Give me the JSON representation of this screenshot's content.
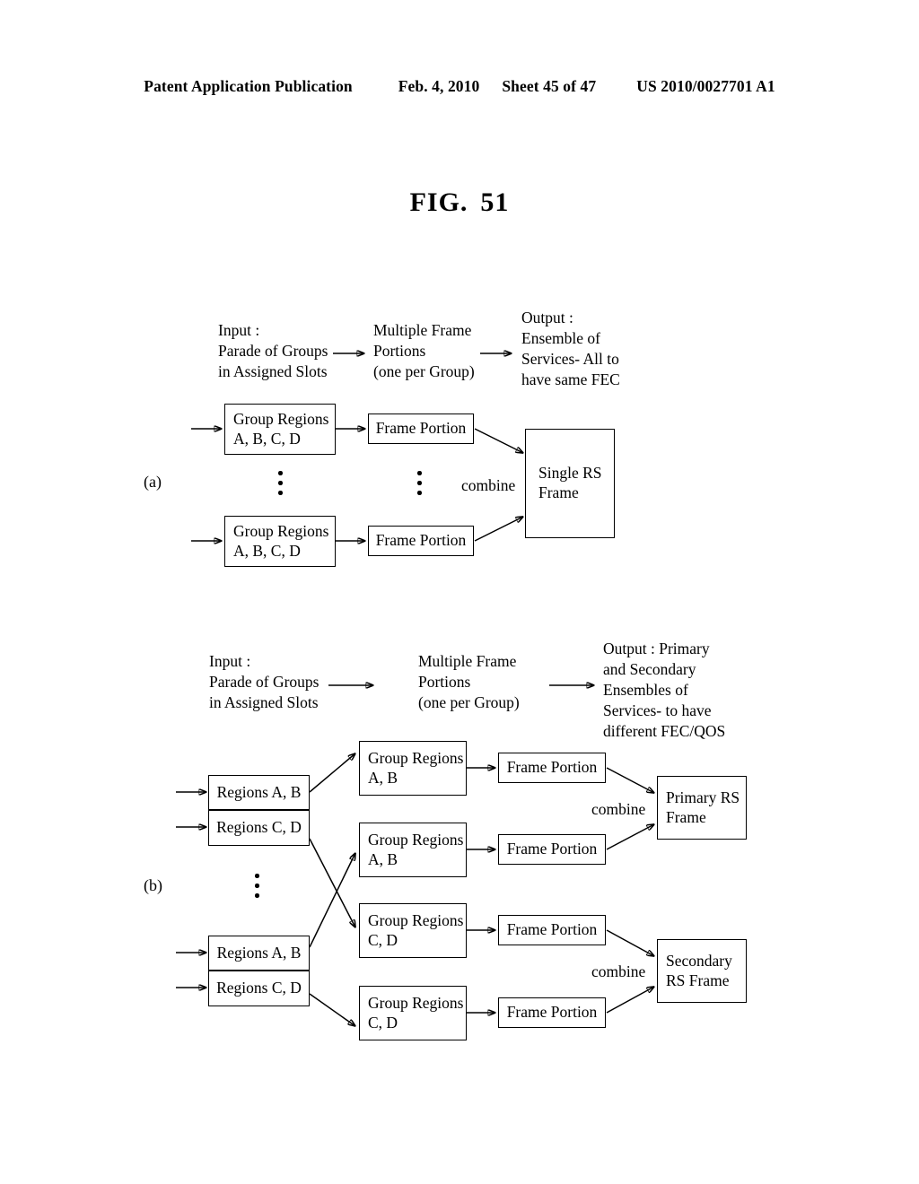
{
  "header": {
    "publication": "Patent Application Publication",
    "date": "Feb. 4, 2010",
    "sheet": "Sheet 45 of 47",
    "patent_number": "US 2010/0027701 A1"
  },
  "figure": {
    "label": "FIG.",
    "number": "51"
  },
  "part_a": {
    "label": "(a)",
    "captions": {
      "input": {
        "line1": "Input :",
        "line2": "Parade of Groups",
        "line3": "in Assigned Slots"
      },
      "middle": {
        "line1": "Multiple Frame",
        "line2": "Portions",
        "line3": "(one per Group)"
      },
      "output": {
        "line1": "Output :",
        "line2": "Ensemble of",
        "line3": "Services- All to",
        "line4": "have same FEC"
      }
    },
    "group_box_top": {
      "line1": "Group Regions",
      "line2": "A, B, C, D"
    },
    "group_box_bottom": {
      "line1": "Group Regions",
      "line2": "A, B, C, D"
    },
    "frame_portion_top": "Frame Portion",
    "frame_portion_bottom": "Frame Portion",
    "combine_label": "combine",
    "rs_frame": {
      "line1": "Single RS",
      "line2": "Frame"
    }
  },
  "part_b": {
    "label": "(b)",
    "captions": {
      "input": {
        "line1": "Input :",
        "line2": "Parade of Groups",
        "line3": "in Assigned Slots"
      },
      "middle": {
        "line1": "Multiple Frame",
        "line2": "Portions",
        "line3": "(one per Group)"
      },
      "output": {
        "line1": "Output : Primary",
        "line2": "and Secondary",
        "line3": "Ensembles of",
        "line4": "Services- to have",
        "line5": "different FEC/QOS"
      }
    },
    "parade_top": {
      "upper": "Regions A, B",
      "lower": "Regions C, D"
    },
    "parade_bottom": {
      "upper": "Regions A, B",
      "lower": "Regions C, D"
    },
    "group_boxes": [
      {
        "line1": "Group Regions",
        "line2": "A, B"
      },
      {
        "line1": "Group Regions",
        "line2": "A, B"
      },
      {
        "line1": "Group Regions",
        "line2": "C, D"
      },
      {
        "line1": "Group Regions",
        "line2": "C, D"
      }
    ],
    "frame_portions": [
      "Frame Portion",
      "Frame Portion",
      "Frame Portion",
      "Frame Portion"
    ],
    "combine_primary": "combine",
    "combine_secondary": "combine",
    "primary_rs_frame": {
      "line1": "Primary RS",
      "line2": "Frame"
    },
    "secondary_rs_frame": {
      "line1": "Secondary",
      "line2": "RS Frame"
    }
  },
  "colors": {
    "ink": "#000000",
    "paper": "#ffffff"
  }
}
